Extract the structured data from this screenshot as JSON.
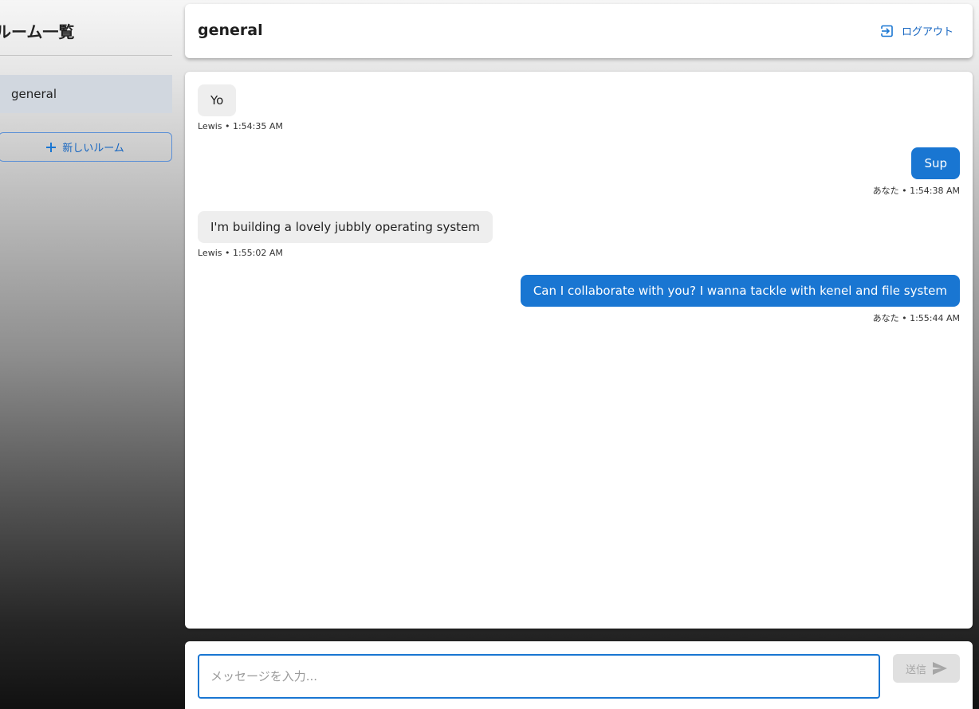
{
  "sidebar": {
    "title": "ルーム一覧",
    "rooms": [
      {
        "label": "general",
        "selected": true
      }
    ],
    "new_room_label": "新しいルーム"
  },
  "header": {
    "room_title": "general",
    "logout_label": "ログアウト"
  },
  "messages": [
    {
      "text": "Yo",
      "sender": "Lewis",
      "time": "1:54:35 AM",
      "meta": "Lewis • 1:54:35 AM",
      "mine": false
    },
    {
      "text": "Sup",
      "sender": "あなた",
      "time": "1:54:38 AM",
      "meta": "あなた • 1:54:38 AM",
      "mine": true
    },
    {
      "text": "I'm building a lovely jubbly operating system",
      "sender": "Lewis",
      "time": "1:55:02 AM",
      "meta": "Lewis • 1:55:02 AM",
      "mine": false
    },
    {
      "text": "Can I collaborate with you? I wanna tackle with kenel and file system",
      "sender": "あなた",
      "time": "1:55:44 AM",
      "meta": "あなた • 1:55:44 AM",
      "mine": true
    }
  ],
  "composer": {
    "placeholder": "メッセージを入力...",
    "value": "",
    "send_label": "送信"
  },
  "colors": {
    "accent": "#1976d2",
    "own_bubble": "#1976d2",
    "other_bubble": "#eeeeee",
    "selected_room": "#d1d7df",
    "send_disabled": "#e0e0e0"
  },
  "icons": {
    "new_room": "plus-icon",
    "logout": "logout-icon",
    "send": "send-icon"
  }
}
